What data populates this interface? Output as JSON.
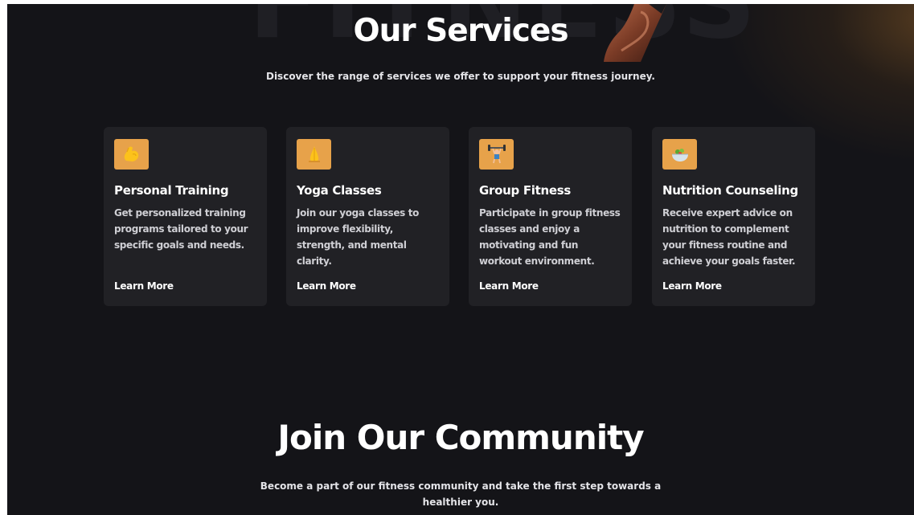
{
  "background_word": "FITNESS",
  "services": {
    "title": "Our Services",
    "subtitle": "Discover the range of services we offer to support your fitness journey.",
    "cards": [
      {
        "icon": "flexed-bicep-icon",
        "title": "Personal Training",
        "description": "Get personalized training programs tailored to your specific goals and needs.",
        "link": "Learn More"
      },
      {
        "icon": "yoga-icon",
        "title": "Yoga Classes",
        "description": "Join our yoga classes to improve flexibility, strength, and mental clarity.",
        "link": "Learn More"
      },
      {
        "icon": "weightlifter-icon",
        "title": "Group Fitness",
        "description": "Participate in group fitness classes and enjoy a motivating and fun workout environment.",
        "link": "Learn More"
      },
      {
        "icon": "salad-bowl-icon",
        "title": "Nutrition Counseling",
        "description": "Receive expert advice on nutrition to complement your fitness routine and achieve your goals faster.",
        "link": "Learn More"
      }
    ]
  },
  "community": {
    "title": "Join Our Community",
    "subtitle": "Become a part of our fitness community and take the first step towards a healthier you."
  },
  "colors": {
    "background": "#141418",
    "card": "#212125",
    "icon_accent": "#e7a24a",
    "text_primary": "#ffffff",
    "text_secondary": "#cfcfd4"
  }
}
